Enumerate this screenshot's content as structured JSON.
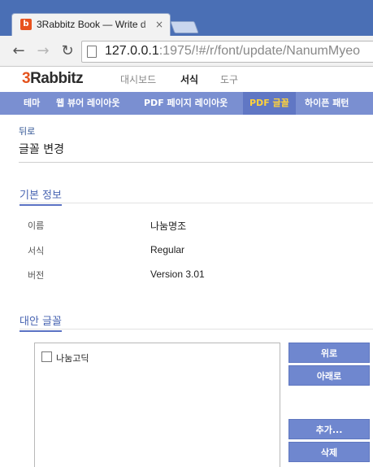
{
  "browser": {
    "favicon_text": "b",
    "tab_title": "3Rabbitz Book — Write d",
    "close_glyph": "×",
    "back_glyph": "←",
    "forward_glyph": "→",
    "reload_glyph": "↻",
    "url_host": "127.0.0.1",
    "url_rest": ":1975/!#/r/font/update/NanumMyeo"
  },
  "app": {
    "logo_digit": "3",
    "logo_text": "Rabbitz",
    "nav": {
      "dashboard": "대시보드",
      "format": "서식",
      "tools": "도구"
    },
    "subnav": {
      "theme": "테마",
      "web_layout": "웹 뷰어 레이아웃",
      "pdf_layout": "PDF 페이지 레이아웃",
      "pdf_font": "PDF 글꼴",
      "hyphenation": "하이픈 패턴"
    },
    "colors": {
      "accent": "#7a8fd1",
      "active_subnav_text": "#ffd23c",
      "logo_accent": "#e4531d"
    }
  },
  "page": {
    "back_label": "뒤로",
    "title": "글꼴 변경",
    "basic_info": {
      "heading": "기본 정보",
      "name_label": "이름",
      "name_value": "나눔명조",
      "style_label": "서식",
      "style_value": "Regular",
      "version_label": "버전",
      "version_value": "Version 3.01"
    },
    "alt_fonts": {
      "heading": "대안 글꼴",
      "items": [
        {
          "label": "나눔고딕",
          "checked": false
        }
      ],
      "buttons": {
        "up": "위로",
        "down": "아래로",
        "add": "추가...",
        "delete": "삭제"
      }
    }
  }
}
